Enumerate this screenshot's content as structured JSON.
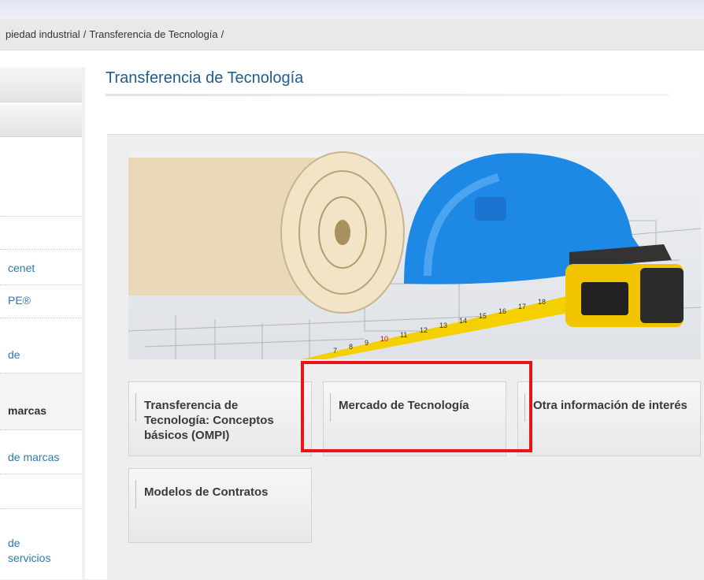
{
  "breadcrumb": {
    "items": [
      "piedad industrial",
      "/",
      "Transferencia de Tecnología",
      "/"
    ]
  },
  "sidebar": {
    "items": [
      {
        "label": "cenet",
        "style": "link"
      },
      {
        "label": "PE®",
        "style": "link"
      },
      {
        "label": "de",
        "style": "link"
      },
      {
        "label": "marcas",
        "style": "strong"
      },
      {
        "label": "de marcas",
        "style": "link"
      },
      {
        "label": "de",
        "style": "link"
      },
      {
        "label": "servicios",
        "style": "link"
      }
    ]
  },
  "main": {
    "title": "Transferencia de Tecnología",
    "tiles": [
      {
        "label": "Transferencia de Tecnología: Conceptos básicos (OMPI)"
      },
      {
        "label": "Mercado de Tecnología"
      },
      {
        "label": "Otra información de interés"
      },
      {
        "label": "Modelos de Contratos"
      }
    ]
  },
  "annotation": {
    "highlight_color": "#e8141a",
    "highlighted_tile": "Mercado de Tecnología"
  },
  "colors": {
    "title": "#1d5d8f",
    "link": "#2a7ab0",
    "helmet": "#1e88e5",
    "tape": "#f5d000"
  }
}
